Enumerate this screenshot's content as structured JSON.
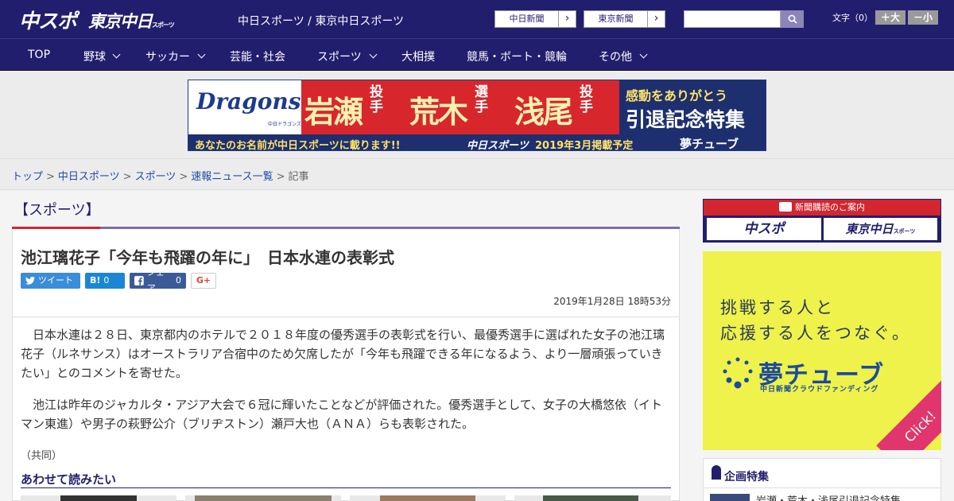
{
  "header": {
    "logo_chuspo": "中スポ",
    "logo_tokyo": "東京中日",
    "logo_tokyo_small": "スポーツ",
    "tagline": "中日スポーツ / 東京中日スポーツ",
    "paper_buttons": [
      "中日新聞",
      "東京新聞"
    ],
    "font_size_label": "文字（0）",
    "font_bigger": "＋大",
    "font_smaller": "－小"
  },
  "nav": {
    "items": [
      {
        "label": "TOP",
        "dropdown": false
      },
      {
        "label": "野球",
        "dropdown": true
      },
      {
        "label": "サッカー",
        "dropdown": true
      },
      {
        "label": "芸能・社会",
        "dropdown": false
      },
      {
        "label": "スポーツ",
        "dropdown": true
      },
      {
        "label": "大相撲",
        "dropdown": false
      },
      {
        "label": "競馬・ボート・競輪",
        "dropdown": false
      },
      {
        "label": "その他",
        "dropdown": true
      }
    ]
  },
  "banner": {
    "logo": "Dragons",
    "logo_sub": "中日ドラゴンズ",
    "names": [
      "岩瀬",
      "荒木",
      "浅尾"
    ],
    "roles": [
      "投手",
      "選手",
      "投手"
    ],
    "thanks": "感動をありがとう",
    "special": "引退記念特集",
    "bottom_text": "あなたのお名前が中日スポーツに載ります!!",
    "bottom_brand": "中日スポーツ",
    "bottom_date": "2019年3月掲載予定",
    "bottom_right": "夢チューブ"
  },
  "breadcrumb": {
    "links": [
      "トップ",
      "中日スポーツ",
      "スポーツ",
      "速報ニュース一覧"
    ],
    "current": "記事",
    "separator": ">"
  },
  "article": {
    "category": "【スポーツ】",
    "title": "池江璃花子「今年も飛躍の年に」　日本水連の表彰式",
    "share": {
      "tweet": "ツイート",
      "hatena_icon": "B!",
      "hatena_count": "0",
      "facebook": "シェア",
      "facebook_count": "0",
      "gplus": "G+"
    },
    "date": "2019年1月28日 18時53分",
    "paragraphs": [
      "　日本水連は２８日、東京都内のホテルで２０１８年度の優秀選手の表彰式を行い、最優秀選手に選ばれた女子の池江璃花子（ルネサンス）はオーストラリア合宿中のため欠席したが「今年も飛躍できる年になるよう、より一層頑張っていきたい」とのコメントを寄せた。",
      "　池江は昨年のジャカルタ・アジア大会で６冠に輝いたことなどが評価された。優秀選手として、女子の大橋悠依（イトマン東進）や男子の萩野公介（ブリヂストン）瀬戸大也（ＡＮＡ）らも表彰された。"
    ],
    "source": "（共同）",
    "read_more": "あわせて読みたい"
  },
  "sidebar": {
    "subscribe_title": "新聞購読のご案内",
    "subscribe_chuspo": "中スポ",
    "subscribe_tokyo": "東京中日",
    "subscribe_tokyo_small": "スポーツ",
    "ad_line1": "挑戦する人と",
    "ad_line2": "応援する人をつなぐ。",
    "ad_brand": "夢チューブ",
    "ad_brand_sub": "中日新聞クラウドファンディング",
    "ad_click": "Click!",
    "feature_title": "企画特集",
    "feature_item": "岩瀬・荒木・浅尾引退記念特集"
  },
  "colors": {
    "brand_navy": "#221e6e",
    "accent_red": "#d3262f",
    "ad_yellow": "#eef24a",
    "ad_pink": "#e0366d"
  }
}
